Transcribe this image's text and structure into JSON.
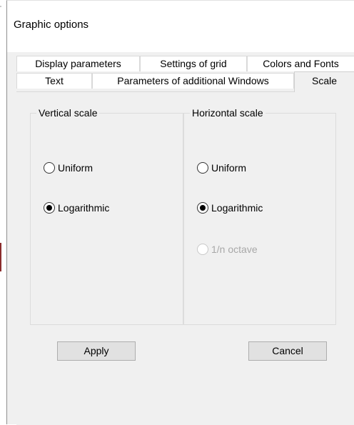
{
  "window": {
    "title": "Graphic options"
  },
  "tabs": {
    "row1": [
      {
        "label": "Display parameters"
      },
      {
        "label": "Settings of grid"
      },
      {
        "label": "Colors and Fonts"
      }
    ],
    "row2": [
      {
        "label": "Text"
      },
      {
        "label": "Parameters of additional Windows"
      },
      {
        "label": "Scale",
        "active": true
      }
    ]
  },
  "scale": {
    "vertical": {
      "legend": "Vertical scale",
      "options": [
        {
          "label": "Uniform",
          "checked": false,
          "enabled": true
        },
        {
          "label": "Logarithmic",
          "checked": true,
          "enabled": true
        }
      ]
    },
    "horizontal": {
      "legend": "Horizontal scale",
      "options": [
        {
          "label": "Uniform",
          "checked": false,
          "enabled": true
        },
        {
          "label": "Logarithmic",
          "checked": true,
          "enabled": true
        },
        {
          "label": "1/n octave",
          "checked": false,
          "enabled": false
        }
      ]
    }
  },
  "buttons": {
    "apply": "Apply",
    "cancel": "Cancel"
  },
  "colors": {
    "window_bg": "#f0f0f0",
    "tab_border": "#d9d9d9",
    "disabled_text": "#a8a8a8"
  }
}
